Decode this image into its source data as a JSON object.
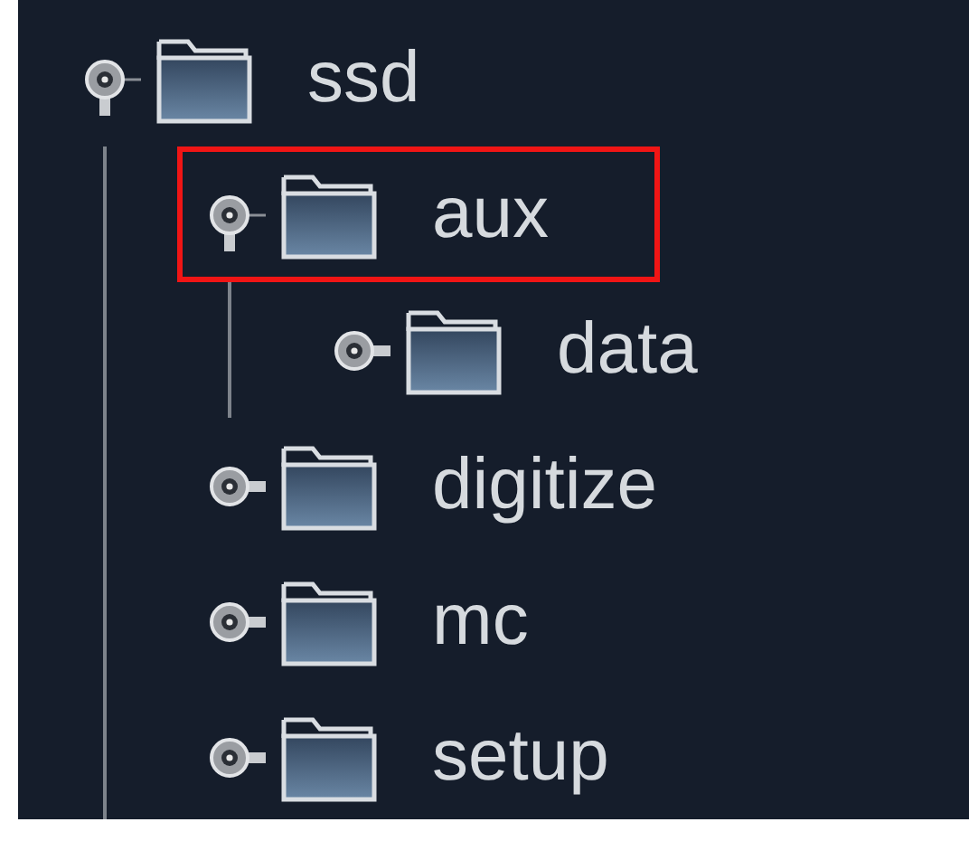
{
  "tree": [
    {
      "label": "ssd",
      "expanded": true,
      "highlighted": false,
      "children": [
        {
          "label": "aux",
          "expanded": true,
          "highlighted": true,
          "children": [
            {
              "label": "data",
              "expanded": false,
              "highlighted": false
            }
          ]
        },
        {
          "label": "digitize",
          "expanded": false,
          "highlighted": false
        },
        {
          "label": "mc",
          "expanded": false,
          "highlighted": false
        },
        {
          "label": "setup",
          "expanded": false,
          "highlighted": false
        }
      ]
    }
  ]
}
